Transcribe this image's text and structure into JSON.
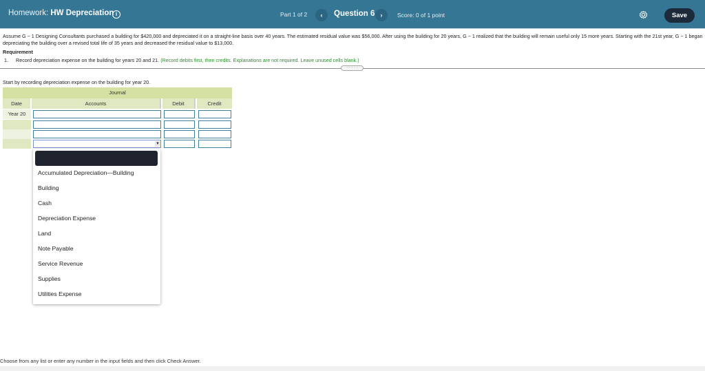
{
  "header": {
    "homework_prefix": "Homework: ",
    "homework_title": "HW Depreciation",
    "info_icon": "i",
    "part": "Part 1 of 2",
    "prev_icon": "‹",
    "question": "Question 6",
    "next_icon": "›",
    "score": "Score: 0 of 1 point",
    "save_label": "Save"
  },
  "problem": {
    "text": "Assume G − 1 Designing Consultants purchased a building for $420,000 and depreciated it on a straight-line basis over 40 years. The estimated residual value was $56,000. After using the building for 20 years, G − 1 realized that the building will remain useful only 15 more years. Starting with the 21st year, G − 1 began depreciating the building over a revised total life of 35 years and decreased the residual value to $13,000.",
    "requirement_heading": "Requirement",
    "requirement_number": "1.",
    "requirement_text": "Record depreciation expense on the building for years 20 and 21. ",
    "requirement_note": "(Record debits first, then credits. Explanations are not required. Leave unused cells blank.)",
    "divider_handle": "· · · · ·"
  },
  "instruction": "Start by recording depreciation expense on the building for year 20.",
  "journal": {
    "title": "Journal",
    "columns": {
      "date": "Date",
      "accounts": "Accounts",
      "debit": "Debit",
      "credit": "Credit"
    },
    "rows": [
      {
        "date": "Year 20",
        "account": "",
        "debit": "",
        "credit": ""
      },
      {
        "date": "",
        "account": "",
        "debit": "",
        "credit": ""
      },
      {
        "date": "",
        "account": "",
        "debit": "",
        "credit": ""
      },
      {
        "date": "",
        "account": "",
        "debit": "",
        "credit": ""
      }
    ],
    "dropdown_arrow": "▼"
  },
  "dropdown": {
    "options": [
      "Accumulated Depreciation—Building",
      "Building",
      "Cash",
      "Depreciation Expense",
      "Land",
      "Note Payable",
      "Service Revenue",
      "Supplies",
      "Utilities Expense"
    ]
  },
  "footer": {
    "text": "Choose from any list or enter any number in the input fields and then click Check Answer."
  },
  "colors": {
    "header_bg": "#347694",
    "save_bg": "#1c2a3a",
    "journal_title_bg": "#d5e0a3",
    "note_green": "#2e8b2e"
  }
}
